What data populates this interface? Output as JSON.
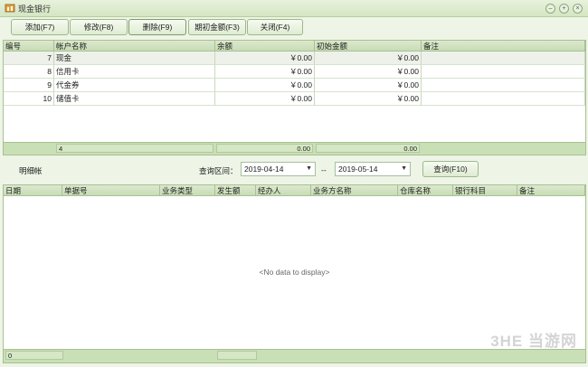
{
  "window": {
    "title": "现金银行"
  },
  "toolbar": {
    "add": "添加(F7)",
    "edit": "修改(F8)",
    "delete": "删除(F9)",
    "opening": "期初金额(F3)",
    "close": "关闭(F4)"
  },
  "accounts": {
    "columns": [
      "编号",
      "帐户名称",
      "余额",
      "初始金额",
      "备注"
    ],
    "rows": [
      {
        "id": "7",
        "name": "现金",
        "balance": "￥0.00",
        "initial": "￥0.00",
        "note": ""
      },
      {
        "id": "8",
        "name": "信用卡",
        "balance": "￥0.00",
        "initial": "￥0.00",
        "note": ""
      },
      {
        "id": "9",
        "name": "代金券",
        "balance": "￥0.00",
        "initial": "￥0.00",
        "note": ""
      },
      {
        "id": "10",
        "name": "储值卡",
        "balance": "￥0.00",
        "initial": "￥0.00",
        "note": ""
      }
    ],
    "footer": {
      "count": "4",
      "balance_total": "0.00",
      "initial_total": "0.00"
    }
  },
  "detail": {
    "label": "明细帐",
    "query_label": "查询区间：",
    "date_from": "2019-04-14",
    "separator": "--",
    "date_to": "2019-05-14",
    "query_button": "查询(F10)",
    "columns": [
      "日期",
      "单据号",
      "业务类型",
      "发生额",
      "经办人",
      "业务方名称",
      "仓库名称",
      "银行科目",
      "备注"
    ],
    "empty_text": "<No data to display>",
    "footer_count": "0"
  },
  "watermark": "3HE 当游网"
}
